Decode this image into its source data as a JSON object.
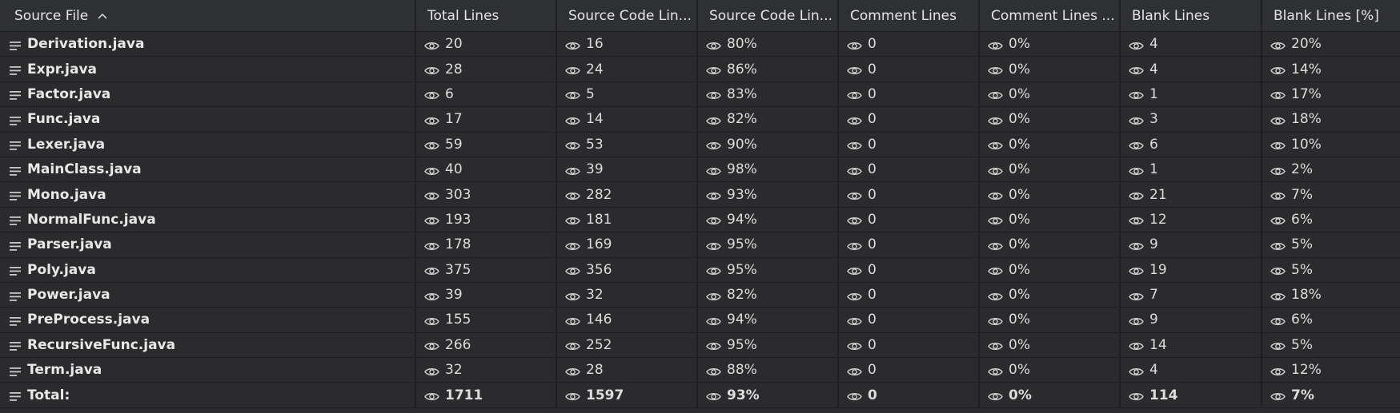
{
  "columns": [
    "Source File",
    "Total Lines",
    "Source Code Lin...",
    "Source Code Lin...",
    "Comment Lines",
    "Comment Lines ...",
    "Blank Lines",
    "Blank Lines [%]"
  ],
  "sort_indicator": "^",
  "rows": [
    {
      "file": "Derivation.java",
      "total": "20",
      "src": "16",
      "src_pct": "80%",
      "comment": "0",
      "comment_pct": "0%",
      "blank": "4",
      "blank_pct": "20%"
    },
    {
      "file": "Expr.java",
      "total": "28",
      "src": "24",
      "src_pct": "86%",
      "comment": "0",
      "comment_pct": "0%",
      "blank": "4",
      "blank_pct": "14%"
    },
    {
      "file": "Factor.java",
      "total": "6",
      "src": "5",
      "src_pct": "83%",
      "comment": "0",
      "comment_pct": "0%",
      "blank": "1",
      "blank_pct": "17%"
    },
    {
      "file": "Func.java",
      "total": "17",
      "src": "14",
      "src_pct": "82%",
      "comment": "0",
      "comment_pct": "0%",
      "blank": "3",
      "blank_pct": "18%"
    },
    {
      "file": "Lexer.java",
      "total": "59",
      "src": "53",
      "src_pct": "90%",
      "comment": "0",
      "comment_pct": "0%",
      "blank": "6",
      "blank_pct": "10%"
    },
    {
      "file": "MainClass.java",
      "total": "40",
      "src": "39",
      "src_pct": "98%",
      "comment": "0",
      "comment_pct": "0%",
      "blank": "1",
      "blank_pct": "2%"
    },
    {
      "file": "Mono.java",
      "total": "303",
      "src": "282",
      "src_pct": "93%",
      "comment": "0",
      "comment_pct": "0%",
      "blank": "21",
      "blank_pct": "7%"
    },
    {
      "file": "NormalFunc.java",
      "total": "193",
      "src": "181",
      "src_pct": "94%",
      "comment": "0",
      "comment_pct": "0%",
      "blank": "12",
      "blank_pct": "6%"
    },
    {
      "file": "Parser.java",
      "total": "178",
      "src": "169",
      "src_pct": "95%",
      "comment": "0",
      "comment_pct": "0%",
      "blank": "9",
      "blank_pct": "5%"
    },
    {
      "file": "Poly.java",
      "total": "375",
      "src": "356",
      "src_pct": "95%",
      "comment": "0",
      "comment_pct": "0%",
      "blank": "19",
      "blank_pct": "5%"
    },
    {
      "file": "Power.java",
      "total": "39",
      "src": "32",
      "src_pct": "82%",
      "comment": "0",
      "comment_pct": "0%",
      "blank": "7",
      "blank_pct": "18%"
    },
    {
      "file": "PreProcess.java",
      "total": "155",
      "src": "146",
      "src_pct": "94%",
      "comment": "0",
      "comment_pct": "0%",
      "blank": "9",
      "blank_pct": "6%"
    },
    {
      "file": "RecursiveFunc.java",
      "total": "266",
      "src": "252",
      "src_pct": "95%",
      "comment": "0",
      "comment_pct": "0%",
      "blank": "14",
      "blank_pct": "5%"
    },
    {
      "file": "Term.java",
      "total": "32",
      "src": "28",
      "src_pct": "88%",
      "comment": "0",
      "comment_pct": "0%",
      "blank": "4",
      "blank_pct": "12%"
    }
  ],
  "total_row": {
    "file": "Total:",
    "total": "1711",
    "src": "1597",
    "src_pct": "93%",
    "comment": "0",
    "comment_pct": "0%",
    "blank": "114",
    "blank_pct": "7%"
  },
  "icons": {
    "row": "lines-icon",
    "value": "eye-icon",
    "sort": "chevron-up-icon"
  },
  "colors": {
    "background": "#2b2b2d",
    "header": "#2f3033",
    "text": "#dcdcdc"
  }
}
